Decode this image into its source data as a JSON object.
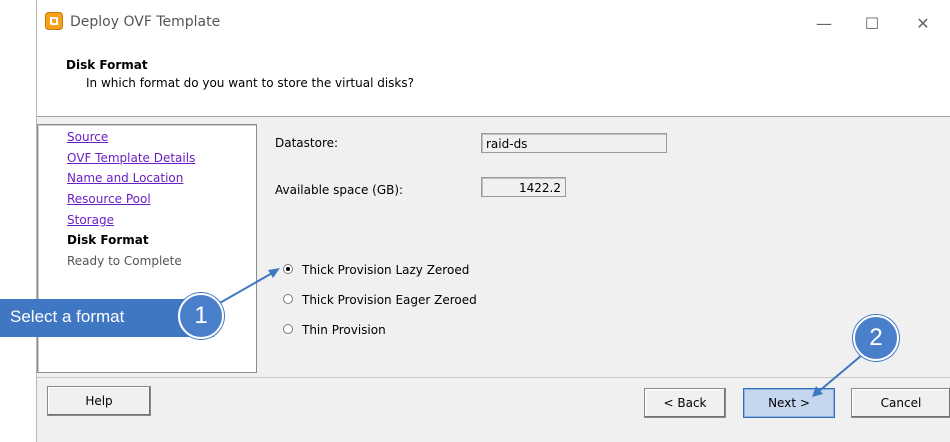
{
  "window": {
    "title": "Deploy OVF Template",
    "controls": {
      "minimize": "—",
      "maximize": "☐",
      "close": "✕"
    }
  },
  "header": {
    "title": "Disk Format",
    "subtitle": "In which format do you want to store the virtual disks?"
  },
  "nav": {
    "items": [
      {
        "label": "Source",
        "state": "link"
      },
      {
        "label": "OVF Template Details",
        "state": "link"
      },
      {
        "label": "Name and Location",
        "state": "link"
      },
      {
        "label": "Resource Pool",
        "state": "link"
      },
      {
        "label": "Storage",
        "state": "link"
      },
      {
        "label": "Disk Format",
        "state": "current"
      },
      {
        "label": "Ready to Complete",
        "state": "disabled"
      }
    ]
  },
  "main": {
    "datastore_label": "Datastore:",
    "datastore_value": "raid-ds",
    "space_label": "Available space (GB):",
    "space_value": "1422.2",
    "formats": [
      {
        "label": "Thick Provision Lazy Zeroed",
        "checked": true
      },
      {
        "label": "Thick Provision Eager Zeroed",
        "checked": false
      },
      {
        "label": "Thin Provision",
        "checked": false
      }
    ]
  },
  "buttons": {
    "help": "Help",
    "back": "< Back",
    "next": "Next >",
    "cancel": "Cancel"
  },
  "annotations": {
    "callout": "Select a format",
    "step1": "1",
    "step2": "2",
    "color": "#3f77c2"
  }
}
